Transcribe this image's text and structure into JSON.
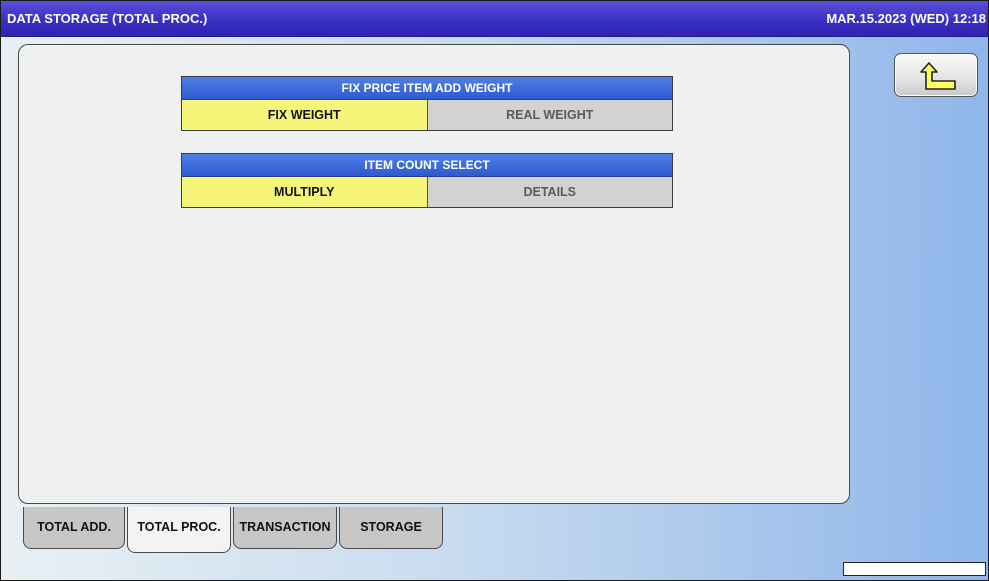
{
  "window": {
    "title": "DATA STORAGE (TOTAL PROC.)",
    "datetime": "MAR.15.2023 (WED)  12:18"
  },
  "groups": [
    {
      "header": "FIX PRICE ITEM ADD WEIGHT",
      "options": [
        {
          "label": "FIX WEIGHT",
          "selected": true
        },
        {
          "label": "REAL WEIGHT",
          "selected": false
        }
      ]
    },
    {
      "header": "ITEM COUNT SELECT",
      "options": [
        {
          "label": "MULTIPLY",
          "selected": true
        },
        {
          "label": "DETAILS",
          "selected": false
        }
      ]
    }
  ],
  "tabs": [
    {
      "label": "TOTAL ADD.",
      "active": false
    },
    {
      "label": "TOTAL PROC.",
      "active": true
    },
    {
      "label": "TRANSACTION",
      "active": false
    },
    {
      "label": "STORAGE",
      "active": false
    }
  ],
  "icons": {
    "back": "return-arrow-icon"
  },
  "colors": {
    "title_bar": "#3a2fc4",
    "group_header": "#2e5ad0",
    "selected_option": "#f5f57a",
    "unselected_option": "#d2d2d2"
  }
}
